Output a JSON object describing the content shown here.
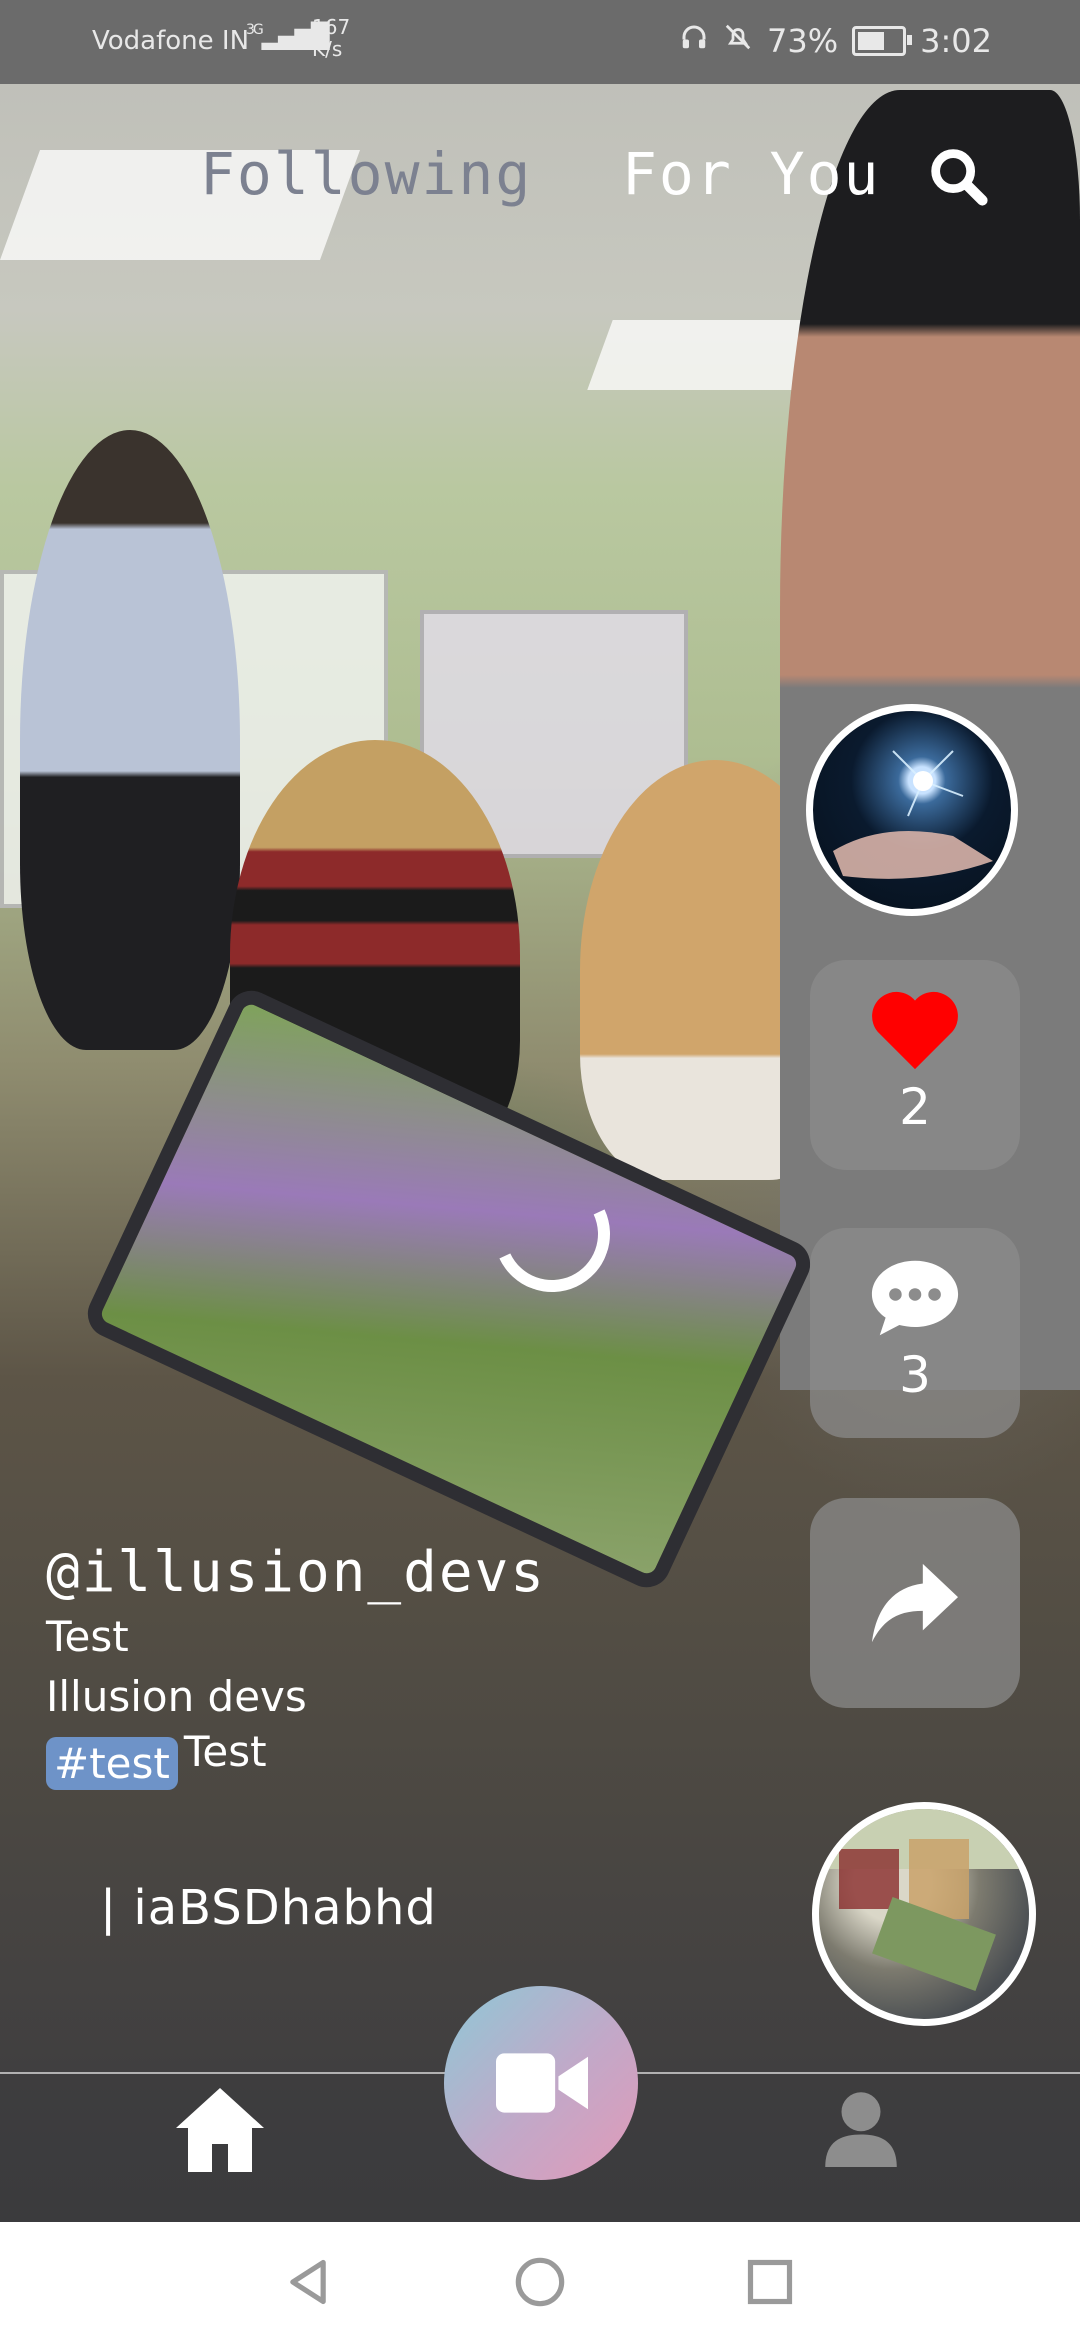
{
  "status_bar": {
    "carrier": "Vodafone IN",
    "network": "3G",
    "speed_value": "167",
    "speed_unit": "K/s",
    "battery": "73%",
    "battery_level": 0.73,
    "time": "3:02"
  },
  "top_nav": {
    "following": "Following",
    "for_you": "For You",
    "search_icon": "search-icon"
  },
  "actions": {
    "likes": "2",
    "comments": "3",
    "like_icon": "heart-icon",
    "comment_icon": "comment-icon",
    "share_icon": "share-icon",
    "heart_color": "#ff0000"
  },
  "caption": {
    "username": "@illusion_devs",
    "line1": "Test",
    "line2": "Illusion devs",
    "hashtag": "#test",
    "tag_text": "Test",
    "music": "| iaBSDhabhd"
  },
  "bottom_nav": {
    "home_icon": "home-icon",
    "record_icon": "video-camera-icon",
    "profile_icon": "profile-icon"
  },
  "system_nav": {
    "back_icon": "back-triangle-icon",
    "home_icon": "home-circle-icon",
    "recents_icon": "recents-square-icon"
  }
}
